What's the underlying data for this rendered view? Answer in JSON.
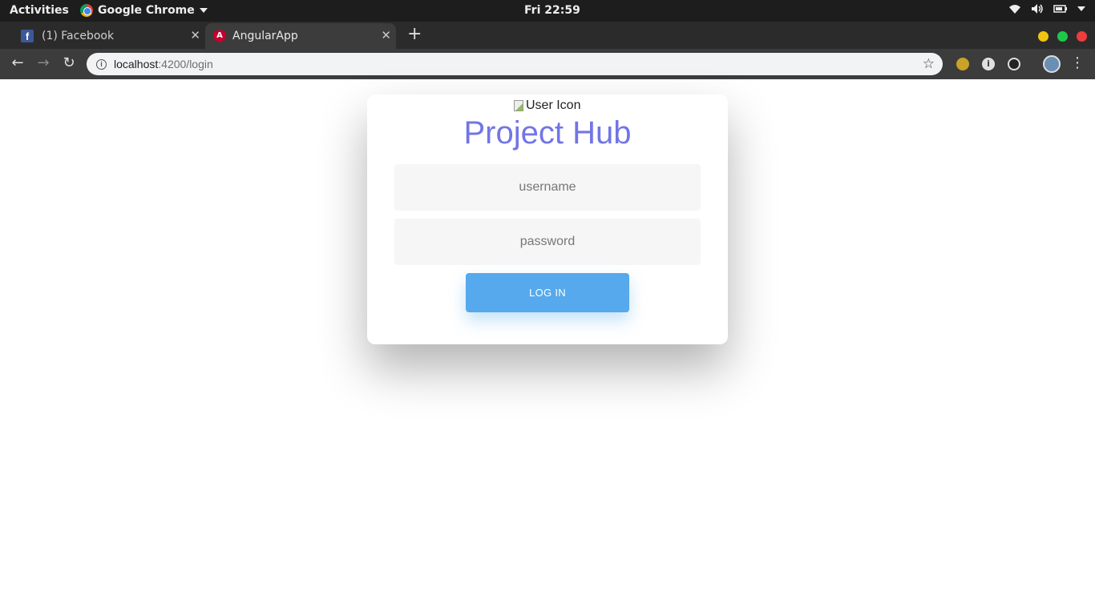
{
  "system_bar": {
    "activities": "Activities",
    "app_name": "Google Chrome",
    "clock": "Fri 22:59"
  },
  "tabs": [
    {
      "title": "(1) Facebook",
      "favicon": "facebook-icon",
      "active": false
    },
    {
      "title": "AngularApp",
      "favicon": "angular-icon",
      "active": true
    }
  ],
  "omnibox": {
    "host": "localhost",
    "path": ":4200/login"
  },
  "login_card": {
    "user_icon_alt": "User Icon",
    "title": "Project Hub",
    "username_placeholder": "username",
    "password_placeholder": "password",
    "login_label": "LOG IN"
  },
  "colors": {
    "title": "#7275e6",
    "button": "#56a9ec",
    "field_bg": "#f6f6f6",
    "window_close": "#ed3d3d",
    "window_maximize": "#1ec94a",
    "window_minimize": "#f1c40f"
  }
}
